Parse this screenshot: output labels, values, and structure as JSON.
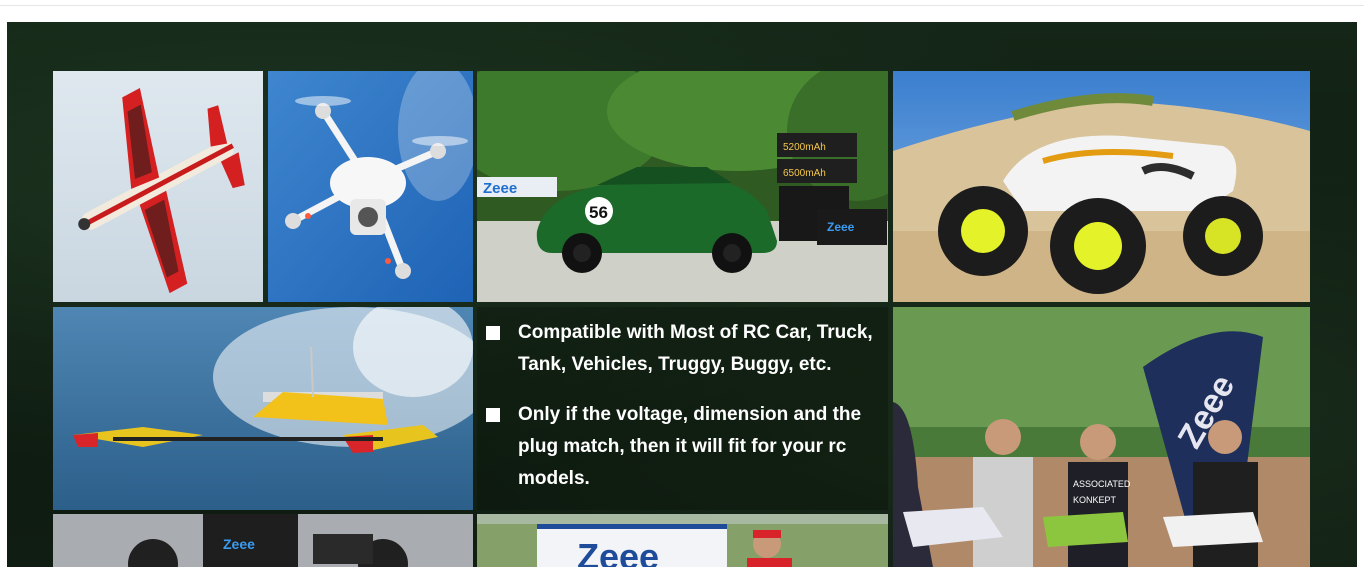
{
  "banner": {
    "bullets": [
      "Compatible with Most of RC Car, Truck, Tank, Vehicles, Truggy, Buggy, etc.",
      "Only if the voltage, dimension and the plug match, then it will fit for your rc models."
    ],
    "car_number": "56",
    "car_brand_sign": "Zeee",
    "battery_labels": [
      "5200mAh",
      "6500mAh"
    ],
    "battery_brand": "Zeee",
    "truck_brand": "Zeee",
    "bottom_sign": "Zeee",
    "team_flag": "Zeee",
    "team_sign_left": "ASSOCIATED",
    "team_sign_right": "KONKEPT"
  },
  "colors": {
    "banner_bg": "#142617",
    "text": "#ffffff",
    "brand_blue": "#1e6fd0"
  }
}
